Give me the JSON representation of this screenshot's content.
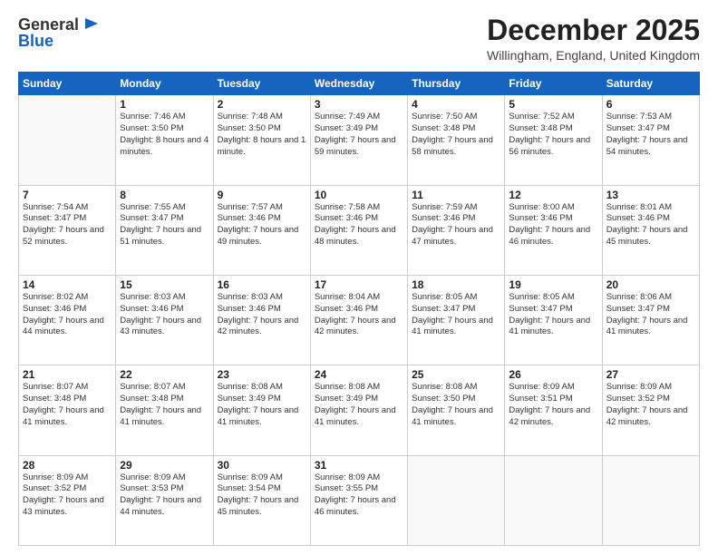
{
  "logo": {
    "general": "General",
    "blue": "Blue"
  },
  "header": {
    "month": "December 2025",
    "location": "Willingham, England, United Kingdom"
  },
  "weekdays": [
    "Sunday",
    "Monday",
    "Tuesday",
    "Wednesday",
    "Thursday",
    "Friday",
    "Saturday"
  ],
  "weeks": [
    [
      {
        "day": "",
        "sunrise": "",
        "sunset": "",
        "daylight": ""
      },
      {
        "day": "1",
        "sunrise": "Sunrise: 7:46 AM",
        "sunset": "Sunset: 3:50 PM",
        "daylight": "Daylight: 8 hours and 4 minutes."
      },
      {
        "day": "2",
        "sunrise": "Sunrise: 7:48 AM",
        "sunset": "Sunset: 3:50 PM",
        "daylight": "Daylight: 8 hours and 1 minute."
      },
      {
        "day": "3",
        "sunrise": "Sunrise: 7:49 AM",
        "sunset": "Sunset: 3:49 PM",
        "daylight": "Daylight: 7 hours and 59 minutes."
      },
      {
        "day": "4",
        "sunrise": "Sunrise: 7:50 AM",
        "sunset": "Sunset: 3:48 PM",
        "daylight": "Daylight: 7 hours and 58 minutes."
      },
      {
        "day": "5",
        "sunrise": "Sunrise: 7:52 AM",
        "sunset": "Sunset: 3:48 PM",
        "daylight": "Daylight: 7 hours and 56 minutes."
      },
      {
        "day": "6",
        "sunrise": "Sunrise: 7:53 AM",
        "sunset": "Sunset: 3:47 PM",
        "daylight": "Daylight: 7 hours and 54 minutes."
      }
    ],
    [
      {
        "day": "7",
        "sunrise": "Sunrise: 7:54 AM",
        "sunset": "Sunset: 3:47 PM",
        "daylight": "Daylight: 7 hours and 52 minutes."
      },
      {
        "day": "8",
        "sunrise": "Sunrise: 7:55 AM",
        "sunset": "Sunset: 3:47 PM",
        "daylight": "Daylight: 7 hours and 51 minutes."
      },
      {
        "day": "9",
        "sunrise": "Sunrise: 7:57 AM",
        "sunset": "Sunset: 3:46 PM",
        "daylight": "Daylight: 7 hours and 49 minutes."
      },
      {
        "day": "10",
        "sunrise": "Sunrise: 7:58 AM",
        "sunset": "Sunset: 3:46 PM",
        "daylight": "Daylight: 7 hours and 48 minutes."
      },
      {
        "day": "11",
        "sunrise": "Sunrise: 7:59 AM",
        "sunset": "Sunset: 3:46 PM",
        "daylight": "Daylight: 7 hours and 47 minutes."
      },
      {
        "day": "12",
        "sunrise": "Sunrise: 8:00 AM",
        "sunset": "Sunset: 3:46 PM",
        "daylight": "Daylight: 7 hours and 46 minutes."
      },
      {
        "day": "13",
        "sunrise": "Sunrise: 8:01 AM",
        "sunset": "Sunset: 3:46 PM",
        "daylight": "Daylight: 7 hours and 45 minutes."
      }
    ],
    [
      {
        "day": "14",
        "sunrise": "Sunrise: 8:02 AM",
        "sunset": "Sunset: 3:46 PM",
        "daylight": "Daylight: 7 hours and 44 minutes."
      },
      {
        "day": "15",
        "sunrise": "Sunrise: 8:03 AM",
        "sunset": "Sunset: 3:46 PM",
        "daylight": "Daylight: 7 hours and 43 minutes."
      },
      {
        "day": "16",
        "sunrise": "Sunrise: 8:03 AM",
        "sunset": "Sunset: 3:46 PM",
        "daylight": "Daylight: 7 hours and 42 minutes."
      },
      {
        "day": "17",
        "sunrise": "Sunrise: 8:04 AM",
        "sunset": "Sunset: 3:46 PM",
        "daylight": "Daylight: 7 hours and 42 minutes."
      },
      {
        "day": "18",
        "sunrise": "Sunrise: 8:05 AM",
        "sunset": "Sunset: 3:47 PM",
        "daylight": "Daylight: 7 hours and 41 minutes."
      },
      {
        "day": "19",
        "sunrise": "Sunrise: 8:05 AM",
        "sunset": "Sunset: 3:47 PM",
        "daylight": "Daylight: 7 hours and 41 minutes."
      },
      {
        "day": "20",
        "sunrise": "Sunrise: 8:06 AM",
        "sunset": "Sunset: 3:47 PM",
        "daylight": "Daylight: 7 hours and 41 minutes."
      }
    ],
    [
      {
        "day": "21",
        "sunrise": "Sunrise: 8:07 AM",
        "sunset": "Sunset: 3:48 PM",
        "daylight": "Daylight: 7 hours and 41 minutes."
      },
      {
        "day": "22",
        "sunrise": "Sunrise: 8:07 AM",
        "sunset": "Sunset: 3:48 PM",
        "daylight": "Daylight: 7 hours and 41 minutes."
      },
      {
        "day": "23",
        "sunrise": "Sunrise: 8:08 AM",
        "sunset": "Sunset: 3:49 PM",
        "daylight": "Daylight: 7 hours and 41 minutes."
      },
      {
        "day": "24",
        "sunrise": "Sunrise: 8:08 AM",
        "sunset": "Sunset: 3:49 PM",
        "daylight": "Daylight: 7 hours and 41 minutes."
      },
      {
        "day": "25",
        "sunrise": "Sunrise: 8:08 AM",
        "sunset": "Sunset: 3:50 PM",
        "daylight": "Daylight: 7 hours and 41 minutes."
      },
      {
        "day": "26",
        "sunrise": "Sunrise: 8:09 AM",
        "sunset": "Sunset: 3:51 PM",
        "daylight": "Daylight: 7 hours and 42 minutes."
      },
      {
        "day": "27",
        "sunrise": "Sunrise: 8:09 AM",
        "sunset": "Sunset: 3:52 PM",
        "daylight": "Daylight: 7 hours and 42 minutes."
      }
    ],
    [
      {
        "day": "28",
        "sunrise": "Sunrise: 8:09 AM",
        "sunset": "Sunset: 3:52 PM",
        "daylight": "Daylight: 7 hours and 43 minutes."
      },
      {
        "day": "29",
        "sunrise": "Sunrise: 8:09 AM",
        "sunset": "Sunset: 3:53 PM",
        "daylight": "Daylight: 7 hours and 44 minutes."
      },
      {
        "day": "30",
        "sunrise": "Sunrise: 8:09 AM",
        "sunset": "Sunset: 3:54 PM",
        "daylight": "Daylight: 7 hours and 45 minutes."
      },
      {
        "day": "31",
        "sunrise": "Sunrise: 8:09 AM",
        "sunset": "Sunset: 3:55 PM",
        "daylight": "Daylight: 7 hours and 46 minutes."
      },
      {
        "day": "",
        "sunrise": "",
        "sunset": "",
        "daylight": ""
      },
      {
        "day": "",
        "sunrise": "",
        "sunset": "",
        "daylight": ""
      },
      {
        "day": "",
        "sunrise": "",
        "sunset": "",
        "daylight": ""
      }
    ]
  ]
}
